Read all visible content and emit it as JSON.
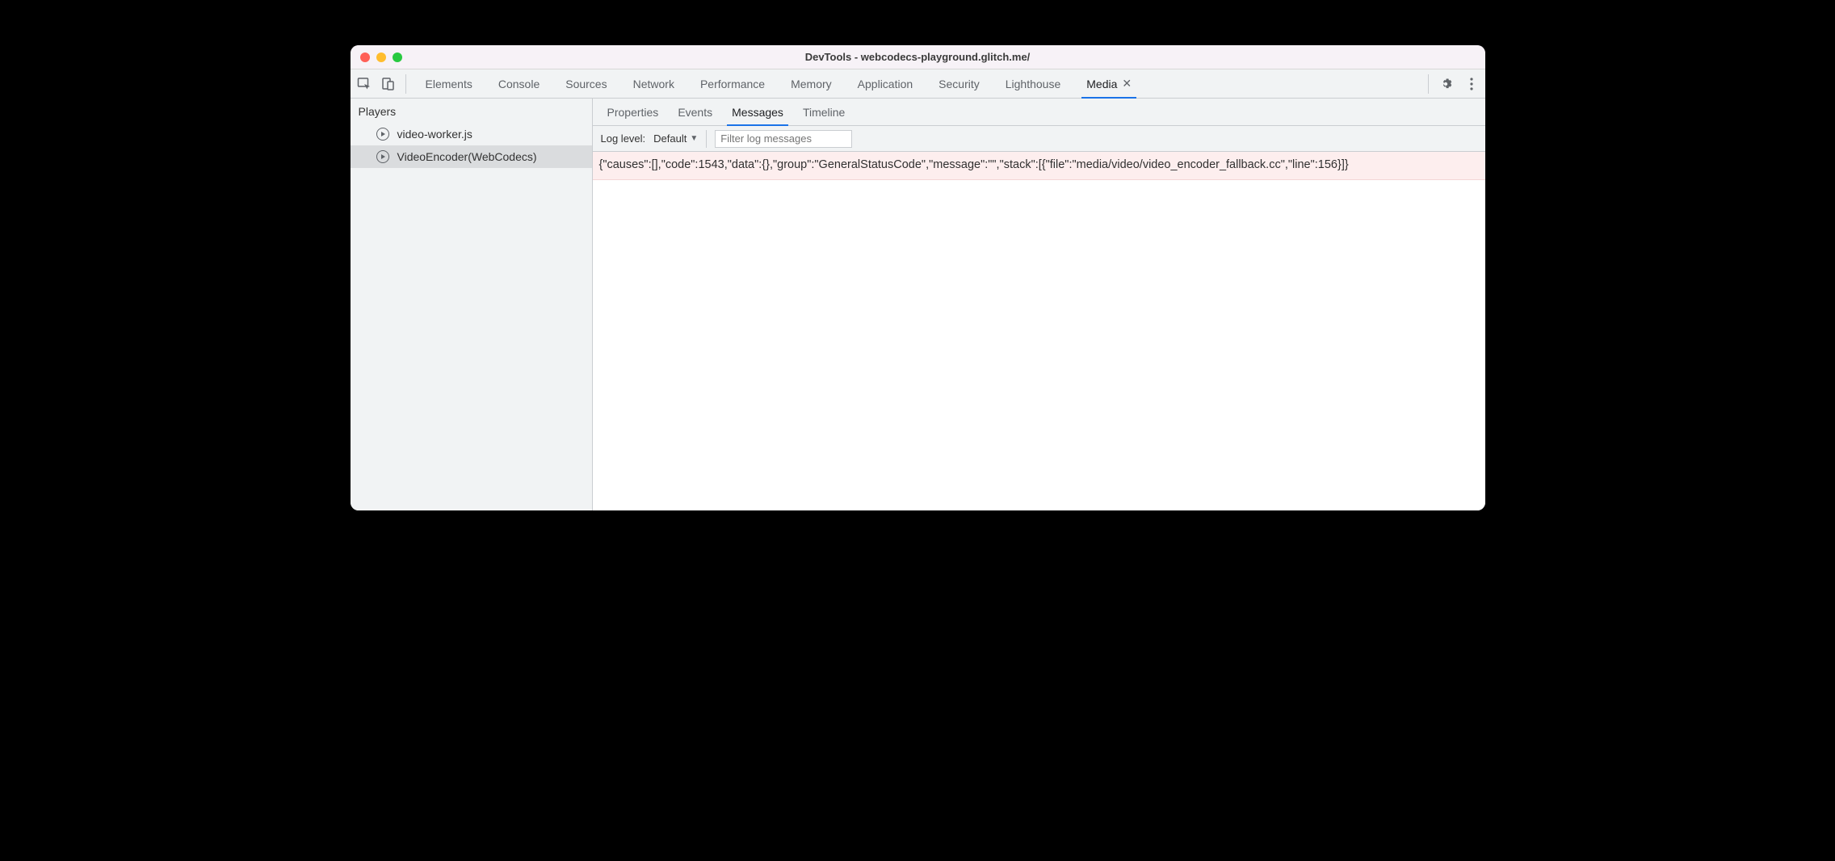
{
  "window": {
    "title": "DevTools - webcodecs-playground.glitch.me/"
  },
  "tabs": {
    "items": [
      {
        "label": "Elements",
        "active": false,
        "closable": false
      },
      {
        "label": "Console",
        "active": false,
        "closable": false
      },
      {
        "label": "Sources",
        "active": false,
        "closable": false
      },
      {
        "label": "Network",
        "active": false,
        "closable": false
      },
      {
        "label": "Performance",
        "active": false,
        "closable": false
      },
      {
        "label": "Memory",
        "active": false,
        "closable": false
      },
      {
        "label": "Application",
        "active": false,
        "closable": false
      },
      {
        "label": "Security",
        "active": false,
        "closable": false
      },
      {
        "label": "Lighthouse",
        "active": false,
        "closable": false
      },
      {
        "label": "Media",
        "active": true,
        "closable": true
      }
    ]
  },
  "sidebar": {
    "header": "Players",
    "items": [
      {
        "label": "video-worker.js",
        "selected": false
      },
      {
        "label": "VideoEncoder(WebCodecs)",
        "selected": true
      }
    ]
  },
  "subtabs": {
    "items": [
      {
        "label": "Properties",
        "active": false
      },
      {
        "label": "Events",
        "active": false
      },
      {
        "label": "Messages",
        "active": true
      },
      {
        "label": "Timeline",
        "active": false
      }
    ]
  },
  "filterbar": {
    "loglevel_label": "Log level:",
    "loglevel_value": "Default",
    "filter_placeholder": "Filter log messages"
  },
  "messages": {
    "rows": [
      "{\"causes\":[],\"code\":1543,\"data\":{},\"group\":\"GeneralStatusCode\",\"message\":\"\",\"stack\":[{\"file\":\"media/video/video_encoder_fallback.cc\",\"line\":156}]}"
    ]
  }
}
